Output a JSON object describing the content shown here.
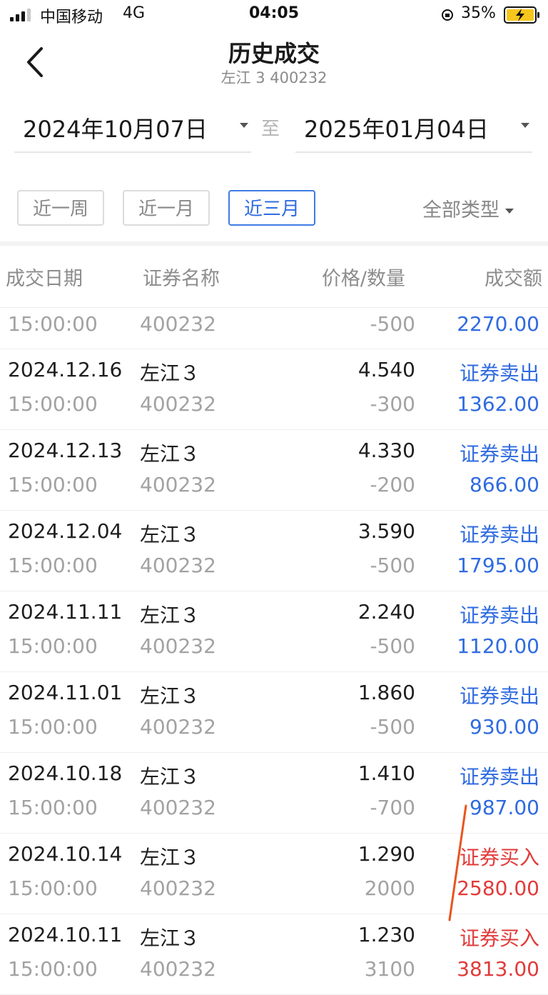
{
  "status_bar": {
    "carrier": "中国移动",
    "network": "4G",
    "time": "04:05",
    "battery_percent": "35%",
    "icons": [
      "signal-icon",
      "orientation-lock-icon",
      "battery-charging-icon"
    ]
  },
  "header": {
    "title": "历史成交",
    "subtitle": "左江 3 400232",
    "back_icon": "chevron-left-icon"
  },
  "date_range": {
    "start": "2024年10月07日",
    "separator": "至",
    "end": "2025年01月04日"
  },
  "filters": {
    "chips": [
      {
        "label": "近一周",
        "active": false
      },
      {
        "label": "近一月",
        "active": false
      },
      {
        "label": "近三月",
        "active": true
      }
    ],
    "type_filter": "全部类型"
  },
  "table": {
    "columns": [
      "成交日期",
      "证券名称",
      "价格/数量",
      "成交额"
    ],
    "partial_top_row": {
      "time": "15:00:00",
      "code": "400232",
      "quantity": "-500",
      "amount": "2270.00",
      "kind": "sell"
    },
    "rows": [
      {
        "date": "2024.12.16",
        "time": "15:00:00",
        "name": "左江３",
        "code": "400232",
        "price": "4.540",
        "quantity": "-300",
        "type": "证券卖出",
        "amount": "1362.00",
        "kind": "sell"
      },
      {
        "date": "2024.12.13",
        "time": "15:00:00",
        "name": "左江３",
        "code": "400232",
        "price": "4.330",
        "quantity": "-200",
        "type": "证券卖出",
        "amount": "866.00",
        "kind": "sell"
      },
      {
        "date": "2024.12.04",
        "time": "15:00:00",
        "name": "左江３",
        "code": "400232",
        "price": "3.590",
        "quantity": "-500",
        "type": "证券卖出",
        "amount": "1795.00",
        "kind": "sell"
      },
      {
        "date": "2024.11.11",
        "time": "15:00:00",
        "name": "左江３",
        "code": "400232",
        "price": "2.240",
        "quantity": "-500",
        "type": "证券卖出",
        "amount": "1120.00",
        "kind": "sell"
      },
      {
        "date": "2024.11.01",
        "time": "15:00:00",
        "name": "左江３",
        "code": "400232",
        "price": "1.860",
        "quantity": "-500",
        "type": "证券卖出",
        "amount": "930.00",
        "kind": "sell"
      },
      {
        "date": "2024.10.18",
        "time": "15:00:00",
        "name": "左江３",
        "code": "400232",
        "price": "1.410",
        "quantity": "-700",
        "type": "证券卖出",
        "amount": "987.00",
        "kind": "sell"
      },
      {
        "date": "2024.10.14",
        "time": "15:00:00",
        "name": "左江３",
        "code": "400232",
        "price": "1.290",
        "quantity": "2000",
        "type": "证券买入",
        "amount": "2580.00",
        "kind": "buy"
      },
      {
        "date": "2024.10.11",
        "time": "15:00:00",
        "name": "左江３",
        "code": "400232",
        "price": "1.230",
        "quantity": "3100",
        "type": "证券买入",
        "amount": "3813.00",
        "kind": "buy"
      }
    ]
  },
  "colors": {
    "sell": "#2f6be0",
    "buy": "#e23a3a",
    "accent": "#3f7be3",
    "annotation_stroke": "#e8541e"
  }
}
